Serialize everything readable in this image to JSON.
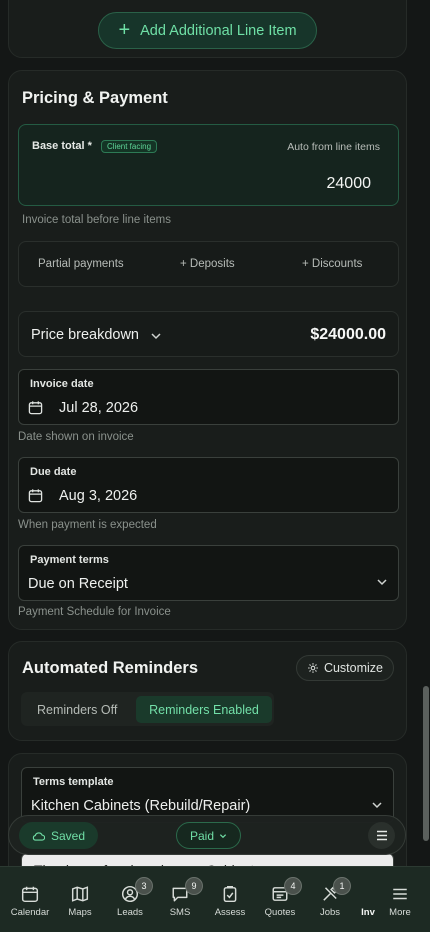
{
  "line_items": {
    "add_button_label": "Add Additional Line Item"
  },
  "pricing": {
    "title": "Pricing & Payment",
    "base_total_label": "Base total *",
    "client_badge": "Client facing",
    "auto_label": "Auto from line items",
    "base_total_value": "24000",
    "base_total_hint": "Invoice total before line items",
    "options": [
      "Partial payments",
      "+ Deposits",
      "+ Discounts"
    ],
    "breakdown_label": "Price breakdown",
    "breakdown_amount": "$24000.00",
    "invoice_date": {
      "label": "Invoice date",
      "value": "Jul 28, 2026",
      "hint": "Date shown on invoice"
    },
    "due_date": {
      "label": "Due date",
      "value": "Aug 3, 2026",
      "hint": "When payment is expected"
    },
    "payment_terms": {
      "label": "Payment terms",
      "value": "Due on Receipt",
      "hint": "Payment Schedule for Invoice"
    }
  },
  "reminders": {
    "title": "Automated Reminders",
    "customize_label": "Customize",
    "off_label": "Reminders Off",
    "on_label": "Reminders Enabled",
    "enabled": true
  },
  "terms": {
    "label": "Terms template",
    "value": "Kitchen Cabinets (Rebuild/Repair)",
    "text_preview": "Thank you for choosing us. Cabinet"
  },
  "status_bar": {
    "saved_label": "Saved",
    "paid_label": "Paid"
  },
  "bottom_nav": [
    {
      "label": "Calendar",
      "icon": "calendar-icon",
      "badge": ""
    },
    {
      "label": "Maps",
      "icon": "map-icon",
      "badge": ""
    },
    {
      "label": "Leads",
      "icon": "user-circle-icon",
      "badge": "3"
    },
    {
      "label": "SMS",
      "icon": "chat-icon",
      "badge": "9"
    },
    {
      "label": "Assess",
      "icon": "clipboard-icon",
      "badge": ""
    },
    {
      "label": "Quotes",
      "icon": "document-icon",
      "badge": "4"
    },
    {
      "label": "Jobs",
      "icon": "tools-icon",
      "badge": "1"
    },
    {
      "label": "Inv",
      "icon": "invoice-icon",
      "badge": ""
    },
    {
      "label": "More",
      "icon": "menu-icon",
      "badge": ""
    }
  ],
  "colors": {
    "accent": "#6fe0a6",
    "background": "#141716",
    "card": "#191d1b",
    "nav_background": "#1d2a23"
  }
}
